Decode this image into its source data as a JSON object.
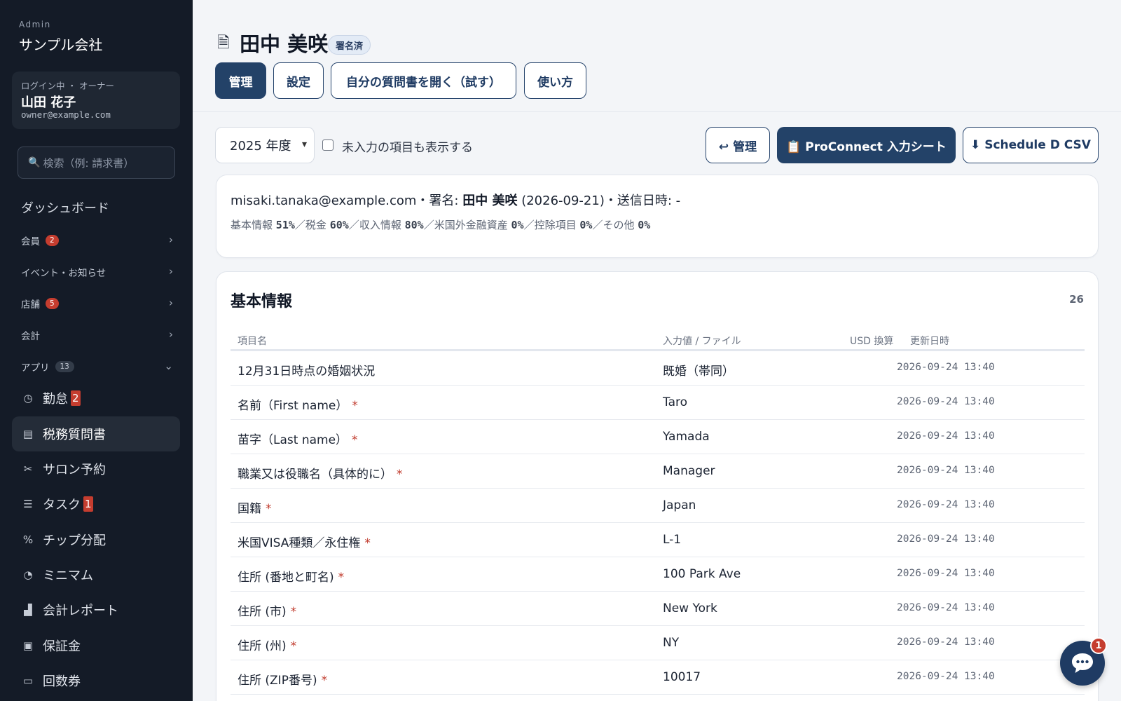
{
  "sidebar": {
    "brand_small": "Admin",
    "brand_name": "サンプル会社",
    "user": {
      "role": "ログイン中 ・ オーナー",
      "name": "山田 花子",
      "email": "owner@example.com"
    },
    "search_placeholder": "検索（例: 請求書）",
    "dashboard": "ダッシュボード",
    "groups": [
      {
        "label": "会員",
        "badge": "2"
      },
      {
        "label": "イベント・お知らせ",
        "badge": ""
      },
      {
        "label": "店舗",
        "badge": "5"
      },
      {
        "label": "会計",
        "badge": ""
      },
      {
        "label": "アプリ",
        "badge": "13"
      }
    ],
    "items": [
      {
        "label": "勤怠",
        "badge": "2",
        "icon": "clock-icon"
      },
      {
        "label": "税務質問書",
        "badge": "",
        "icon": "document-icon"
      },
      {
        "label": "サロン予約",
        "badge": "",
        "icon": "scissors-icon"
      },
      {
        "label": "タスク",
        "badge": "1",
        "icon": "checklist-icon"
      },
      {
        "label": "チップ分配",
        "badge": "",
        "icon": "percent-icon"
      },
      {
        "label": "ミニマム",
        "badge": "",
        "icon": "gauge-icon"
      },
      {
        "label": "会計レポート",
        "badge": "",
        "icon": "chart-icon"
      },
      {
        "label": "保証金",
        "badge": "",
        "icon": "receipt-icon"
      },
      {
        "label": "回数券",
        "badge": "",
        "icon": "ticket-icon"
      }
    ]
  },
  "header": {
    "title": "田中 美咲",
    "status": "署名済",
    "tabs": [
      "管理",
      "設定",
      "自分の質問書を開く（試す）",
      "使い方"
    ]
  },
  "toolbar": {
    "year": "2025 年度",
    "show_empty_label": "未入力の項目も表示する",
    "back_button": "↩ 管理",
    "proconnect_button": "📋 ProConnect 入力シート",
    "csv_button": "⬇ Schedule D CSV"
  },
  "summary": {
    "email": "misaki.tanaka@example.com",
    "sign_prefix": "・署名: ",
    "signer": "田中 美咲",
    "sign_date": " (2026-09-21)",
    "sent_label": "・送信日時: ",
    "sent_value": "-",
    "progress": [
      {
        "label": "基本情報",
        "pct": "51%"
      },
      {
        "label": "税金",
        "pct": "60%"
      },
      {
        "label": "収入情報",
        "pct": "80%"
      },
      {
        "label": "米国外金融資産",
        "pct": "0%"
      },
      {
        "label": "控除項目",
        "pct": "0%"
      },
      {
        "label": "その他",
        "pct": "0%"
      }
    ],
    "separator": "／"
  },
  "section": {
    "title": "基本情報",
    "count": "26",
    "columns": [
      "項目名",
      "入力値 / ファイル",
      "USD 換算",
      "更新日時"
    ],
    "rows": [
      {
        "name": "12月31日時点の婚姻状況",
        "required": "",
        "value": "既婚（帯同）",
        "usd": "",
        "updated": "2026-09-24 13:40"
      },
      {
        "name": "名前（First name）",
        "required": "*",
        "value": "Taro",
        "usd": "",
        "updated": "2026-09-24 13:40"
      },
      {
        "name": "苗字（Last name）",
        "required": "*",
        "value": "Yamada",
        "usd": "",
        "updated": "2026-09-24 13:40"
      },
      {
        "name": "職業又は役職名（具体的に）",
        "required": "*",
        "value": "Manager",
        "usd": "",
        "updated": "2026-09-24 13:40"
      },
      {
        "name": "国籍",
        "required": "*",
        "value": "Japan",
        "usd": "",
        "updated": "2026-09-24 13:40"
      },
      {
        "name": "米国VISA種類／永住権",
        "required": "*",
        "value": "L-1",
        "usd": "",
        "updated": "2026-09-24 13:40"
      },
      {
        "name": "住所 (番地と町名)",
        "required": "*",
        "value": "100 Park Ave",
        "usd": "",
        "updated": "2026-09-24 13:40"
      },
      {
        "name": "住所 (市)",
        "required": "*",
        "value": "New York",
        "usd": "",
        "updated": "2026-09-24 13:40"
      },
      {
        "name": "住所 (州)",
        "required": "*",
        "value": "NY",
        "usd": "",
        "updated": "2026-09-24 13:40"
      },
      {
        "name": "住所 (ZIP番号)",
        "required": "*",
        "value": "10017",
        "usd": "",
        "updated": "2026-09-24 13:40"
      }
    ]
  },
  "chat": {
    "badge": "1"
  },
  "colors": {
    "sidebar_bg": "#141b27",
    "primary": "#234268",
    "danger": "#c53d2f",
    "page_bg": "#f3f5f8"
  }
}
